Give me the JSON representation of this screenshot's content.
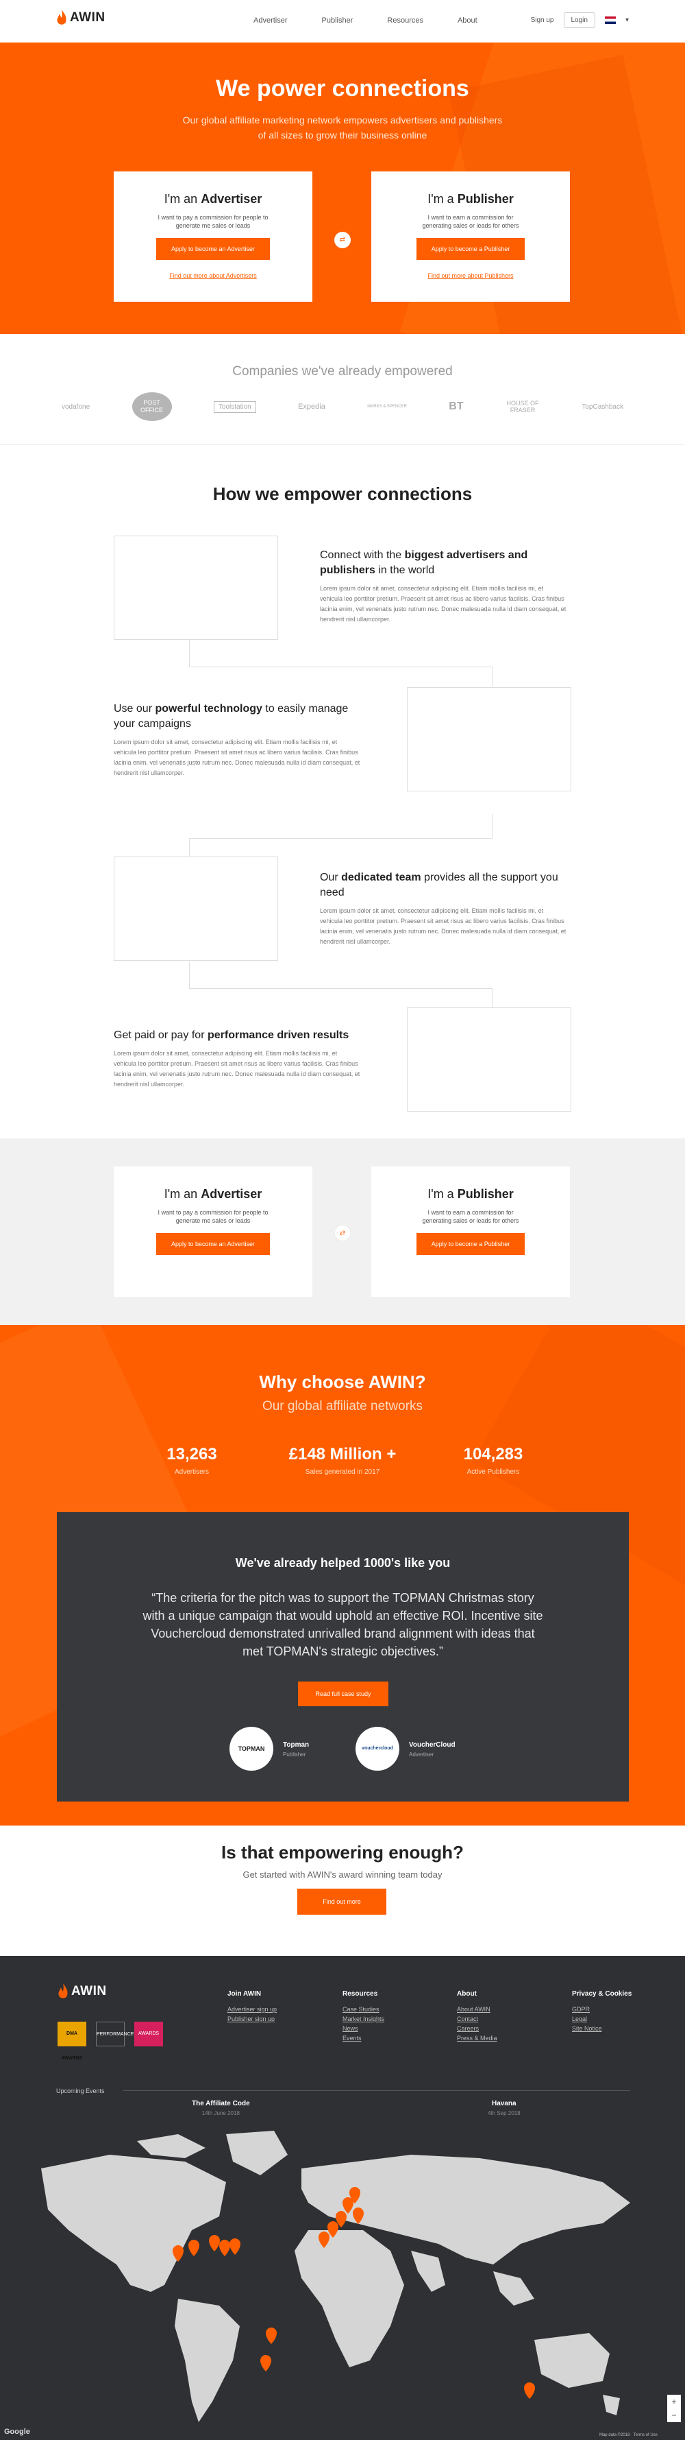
{
  "nav": {
    "logo": "AWIN",
    "links": [
      "Advertiser",
      "Publisher",
      "Resources",
      "About"
    ],
    "signup": "Sign up",
    "login": "Login"
  },
  "hero": {
    "title": "We power connections",
    "subtitle": "Our global affiliate marketing network empowers advertisers and publishers of all sizes to grow their business online",
    "advertiser": {
      "prefix": "I'm an ",
      "role": "Advertiser",
      "desc": "I want to pay a commission for people to generate me sales or leads",
      "button": "Apply to become an Advertiser",
      "link": "Find out more about Advertisers"
    },
    "publisher": {
      "prefix": "I'm a ",
      "role": "Publisher",
      "desc": "I want to earn a commission for generating sales or leads for others",
      "button": "Apply to become a Publisher",
      "link": "Find out more about Publishers"
    }
  },
  "companies": {
    "title": "Companies we've already empowered",
    "logos": [
      "vodafone",
      "POST OFFICE",
      "Toolstation",
      "Expedia",
      "MARKS & SPENCER",
      "BT",
      "HOUSE OF FRASER",
      "TopCashback"
    ]
  },
  "how": {
    "title": "How we empower connections",
    "steps": [
      {
        "pre": "Connect with the ",
        "bold": "biggest advertisers and publishers",
        "post": " in the world",
        "body": "Lorem ipsum dolor sit amet, consectetur adipiscing elit. Etiam mollis facilisis mi, et vehicula leo porttitor pretium. Praesent sit amet risus ac libero varius facilisis. Cras finibus lacinia enim, vel venenatis justo rutrum nec. Donec malesuada nulla id diam consequat, et hendrerit nisl ullamcorper."
      },
      {
        "pre": "Use our ",
        "bold": "powerful technology",
        "post": " to easily manage your campaigns",
        "body": "Lorem ipsum dolor sit amet, consectetur adipiscing elit. Etiam mollis facilisis mi, et vehicula leo porttitor pretium. Praesent sit amet risus ac libero varius facilisis. Cras finibus lacinia enim, vel venenatis justo rutrum nec. Donec malesuada nulla id diam consequat, et hendrerit nisl ullamcorper."
      },
      {
        "pre": "Our ",
        "bold": "dedicated team",
        "post": " provides all the support you need",
        "body": "Lorem ipsum dolor sit amet, consectetur adipiscing elit. Etiam mollis facilisis mi, et vehicula leo porttitor pretium. Praesent sit amet risus ac libero varius facilisis. Cras finibus lacinia enim, vel venenatis justo rutrum nec. Donec malesuada nulla id diam consequat, et hendrerit nisl ullamcorper."
      },
      {
        "pre": "Get paid or pay for ",
        "bold": "performance driven results",
        "post": "",
        "body": "Lorem ipsum dolor sit amet, consectetur adipiscing elit. Etiam mollis facilisis mi, et vehicula leo porttitor pretium. Praesent sit amet risus ac libero varius facilisis. Cras finibus lacinia enim, vel venenatis justo rutrum nec. Donec malesuada nulla id diam consequat, et hendrerit nisl ullamcorper."
      }
    ]
  },
  "why": {
    "title": "Why choose AWIN?",
    "subtitle": "Our global affiliate networks",
    "stats": [
      {
        "num": "13,263",
        "label": "Advertisers"
      },
      {
        "num": "£148 Million +",
        "label": "Sales generated in 2017"
      },
      {
        "num": "104,283",
        "label": "Active Publishers"
      }
    ],
    "testimonial": {
      "title": "We've already helped 1000's like you",
      "quote": "“The criteria for the pitch was to support the TOPMAN Christmas story with a unique campaign that would uphold an effective ROI. Incentive site Vouchercloud demonstrated unrivalled brand alignment with ideas that met TOPMAN's strategic objectives.”",
      "button": "Read full case study",
      "a_logo": "TOPMAN",
      "a_name": "Topman",
      "a_role": "Publisher",
      "b_logo": "vouchercloud",
      "b_name": "VoucherCloud",
      "b_role": "Advertiser"
    }
  },
  "empower": {
    "title": "Is that empowering enough?",
    "subtitle": "Get started with AWIN's award winning team today",
    "button": "Find out more"
  },
  "footer": {
    "logo": "AWIN",
    "awards": [
      "DMA AWARDS",
      "PERFORMANCE",
      "AWARDS"
    ],
    "cols": [
      {
        "title": "Join AWIN",
        "links": [
          "Advertiser sign up",
          "Publisher sign up"
        ]
      },
      {
        "title": "Resources",
        "links": [
          "Case Studies",
          "Market Insights",
          "News",
          "Events"
        ]
      },
      {
        "title": "About",
        "links": [
          "About AWIN",
          "Contact",
          "Careers",
          "Press & Media"
        ]
      },
      {
        "title": "Privacy & Cookies",
        "links": [
          "GDPR",
          "Legal",
          "Site Notice"
        ]
      }
    ],
    "events_label": "Upcoming Events",
    "events": [
      {
        "name": "The Affiliate Code",
        "date": "14th June 2018"
      },
      {
        "name": "Havana",
        "date": "4th Sep 2018"
      }
    ],
    "map_attr": "Map data ©2018 · Terms of Use",
    "google": "Google",
    "colors": {
      "accent": "#fe5e00",
      "dark": "#2e3033"
    }
  }
}
